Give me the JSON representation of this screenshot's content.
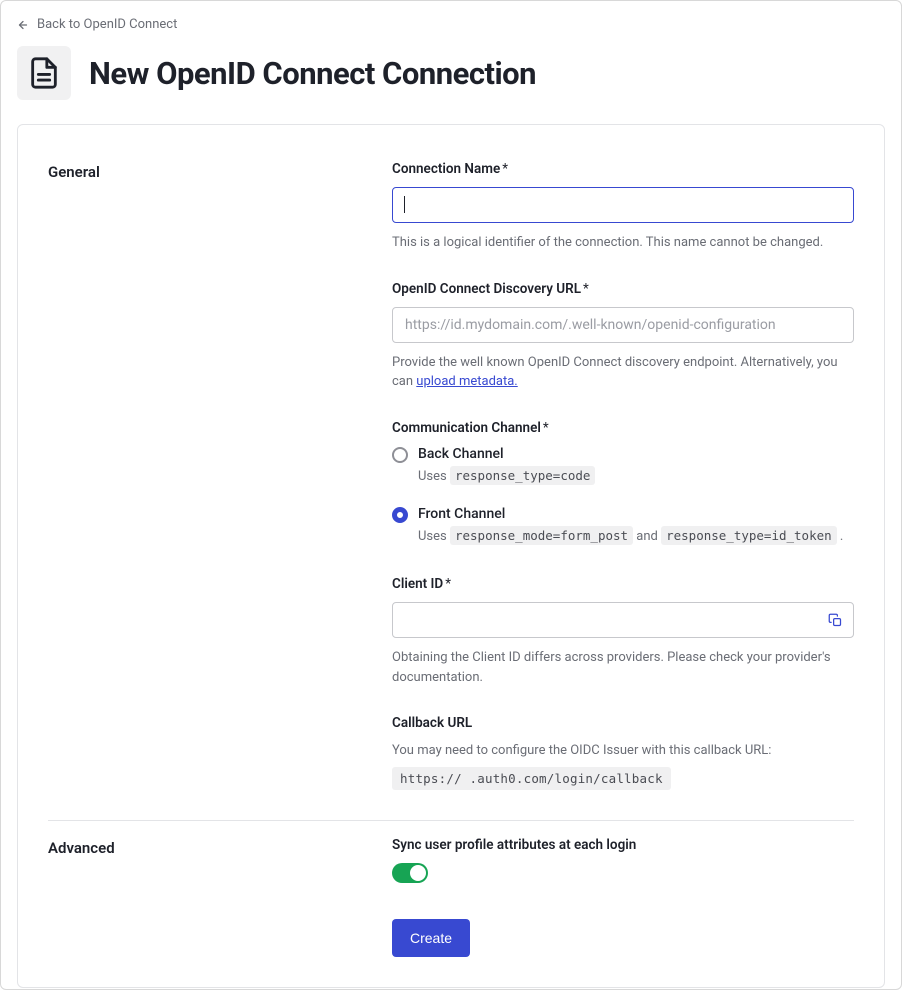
{
  "nav": {
    "back_label": "Back to OpenID Connect"
  },
  "header": {
    "title": "New OpenID Connect Connection"
  },
  "sections": {
    "general": {
      "label": "General",
      "connection_name": {
        "label": "Connection Name",
        "required": "*",
        "value": "",
        "help": "This is a logical identifier of the connection. This name cannot be changed."
      },
      "discovery_url": {
        "label": "OpenID Connect Discovery URL",
        "required": "*",
        "placeholder": "https://id.mydomain.com/.well-known/openid-configuration",
        "value": "",
        "help_pre": "Provide the well known OpenID Connect discovery endpoint. Alternatively, you can ",
        "help_link": "upload metadata."
      },
      "channel": {
        "label": "Communication Channel",
        "required": "*",
        "options": {
          "back": {
            "title": "Back Channel",
            "desc_pre": "Uses ",
            "code": "response_type=code",
            "selected": false
          },
          "front": {
            "title": "Front Channel",
            "desc_pre": "Uses ",
            "code1": "response_mode=form_post",
            "mid": " and ",
            "code2": "response_type=id_token",
            "suffix": " .",
            "selected": true
          }
        }
      },
      "client_id": {
        "label": "Client ID",
        "required": "*",
        "value": "",
        "help": "Obtaining the Client ID differs across providers. Please check your provider's documentation."
      },
      "callback": {
        "label": "Callback URL",
        "help": "You may need to configure the OIDC Issuer with this callback URL:",
        "value": "https://            .auth0.com/login/callback"
      }
    },
    "advanced": {
      "label": "Advanced",
      "sync": {
        "label": "Sync user profile attributes at each login",
        "enabled": true
      }
    }
  },
  "actions": {
    "create": "Create"
  }
}
